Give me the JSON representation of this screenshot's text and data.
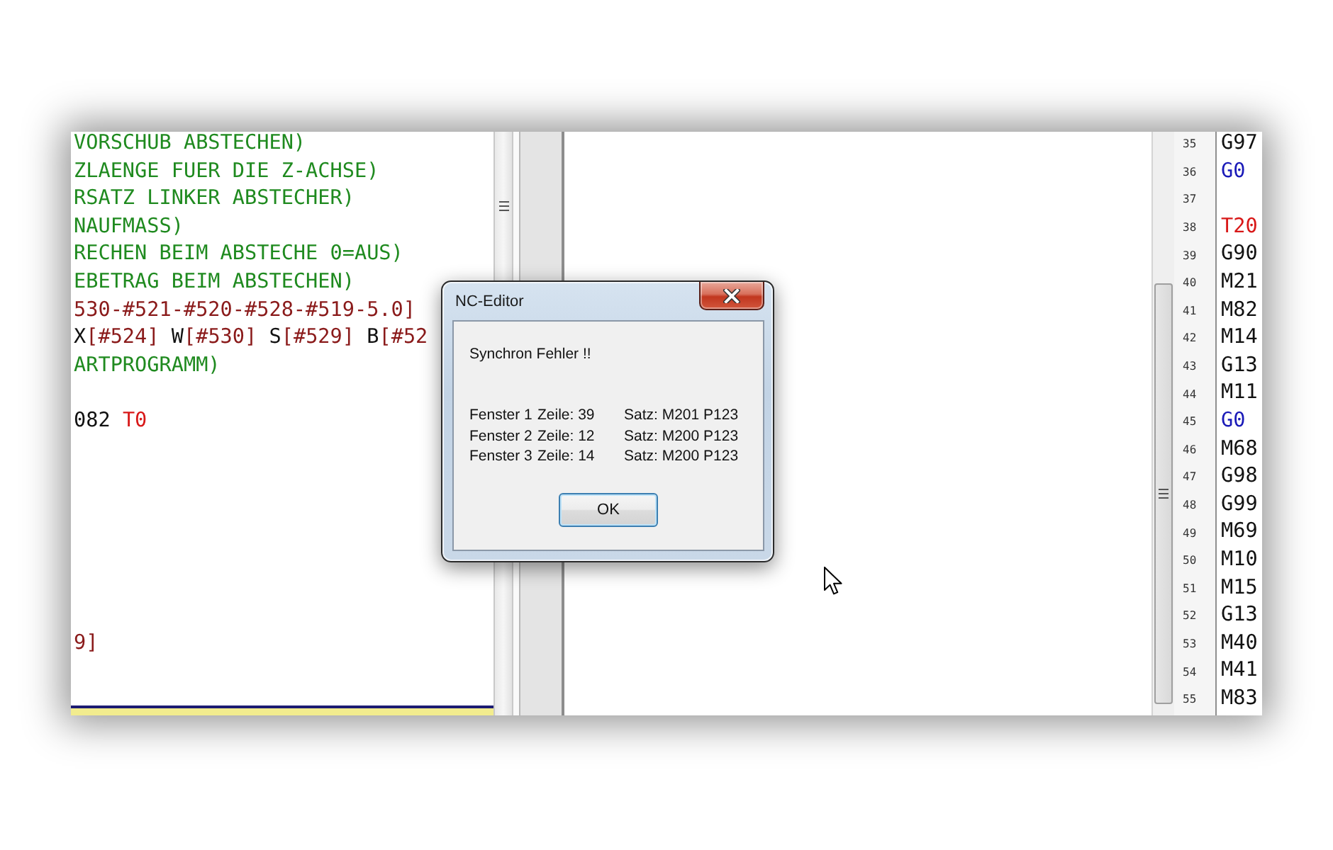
{
  "left_editor": {
    "blocks": [
      {
        "lines": [
          {
            "segments": [
              {
                "text": "VORSCHUB ABSTECHEN)",
                "kind": "comment"
              }
            ]
          },
          {
            "segments": [
              {
                "text": "ZLAENGE FUER DIE Z-ACHSE)",
                "kind": "comment"
              }
            ]
          },
          {
            "segments": [
              {
                "text": "RSATZ LINKER ABSTECHER)",
                "kind": "comment"
              }
            ]
          },
          {
            "segments": [
              {
                "text": "NAUFMASS)",
                "kind": "comment"
              }
            ]
          },
          {
            "segments": [
              {
                "text": "RECHEN BEIM ABSTECHE 0=AUS)",
                "kind": "comment"
              }
            ]
          },
          {
            "segments": [
              {
                "text": "EBETRAG BEIM ABSTECHEN)",
                "kind": "comment"
              }
            ]
          },
          {
            "segments": [
              {
                "text": "530-#521-#520-#528-#519-5.0]",
                "kind": "param"
              }
            ]
          },
          {
            "segments": [
              {
                "text": "X",
                "kind": "plain"
              },
              {
                "text": "[#524]",
                "kind": "param"
              },
              {
                "text": " W",
                "kind": "plain"
              },
              {
                "text": "[#530]",
                "kind": "param"
              },
              {
                "text": " S",
                "kind": "plain"
              },
              {
                "text": "[#529]",
                "kind": "param"
              },
              {
                "text": " B",
                "kind": "plain"
              },
              {
                "text": "[#52",
                "kind": "param"
              }
            ]
          },
          {
            "segments": [
              {
                "text": "ARTPROGRAMM)",
                "kind": "comment"
              }
            ]
          }
        ]
      },
      {
        "lines": [
          {
            "segments": [
              {
                "text": "082 ",
                "kind": "plain"
              },
              {
                "text": "T0",
                "kind": "tool"
              }
            ]
          }
        ]
      },
      {
        "lines": [
          {
            "segments": [
              {
                "text": "9]",
                "kind": "param"
              }
            ]
          }
        ]
      }
    ]
  },
  "right_editor": {
    "lines": [
      {
        "number": "35",
        "segments": [
          {
            "text": "G97",
            "kind": "plain"
          }
        ]
      },
      {
        "number": "36",
        "segments": [
          {
            "text": "G0",
            "kind": "rapid"
          }
        ]
      },
      {
        "number": "37"
      },
      {
        "number": "38",
        "segments": [
          {
            "text": "T20",
            "kind": "tool"
          }
        ]
      },
      {
        "number": "39",
        "segments": [
          {
            "text": "G90",
            "kind": "plain"
          }
        ]
      },
      {
        "number": "40",
        "segments": [
          {
            "text": "M21",
            "kind": "plain"
          }
        ]
      },
      {
        "number": "41",
        "segments": [
          {
            "text": "M82",
            "kind": "plain"
          }
        ]
      },
      {
        "number": "42",
        "segments": [
          {
            "text": "M14",
            "kind": "plain"
          }
        ]
      },
      {
        "number": "43",
        "segments": [
          {
            "text": "G13",
            "kind": "plain"
          }
        ]
      },
      {
        "number": "44",
        "segments": [
          {
            "text": "M11",
            "kind": "plain"
          }
        ]
      },
      {
        "number": "45",
        "segments": [
          {
            "text": "G0",
            "kind": "rapid"
          }
        ]
      },
      {
        "number": "46",
        "segments": [
          {
            "text": "M68",
            "kind": "plain"
          }
        ]
      },
      {
        "number": "47",
        "segments": [
          {
            "text": "G98",
            "kind": "plain"
          }
        ]
      },
      {
        "number": "48",
        "segments": [
          {
            "text": "G99",
            "kind": "plain"
          }
        ]
      },
      {
        "number": "49",
        "segments": [
          {
            "text": "M69",
            "kind": "plain"
          }
        ]
      },
      {
        "number": "50",
        "segments": [
          {
            "text": "M10",
            "kind": "plain"
          }
        ]
      },
      {
        "number": "51",
        "segments": [
          {
            "text": "M15",
            "kind": "plain"
          }
        ]
      },
      {
        "number": "52",
        "segments": [
          {
            "text": "G13",
            "kind": "plain"
          }
        ]
      },
      {
        "number": "53",
        "segments": [
          {
            "text": "M40",
            "kind": "plain"
          }
        ]
      },
      {
        "number": "54",
        "segments": [
          {
            "text": "M41",
            "kind": "plain"
          }
        ]
      },
      {
        "number": "55",
        "segments": [
          {
            "text": "M83",
            "kind": "plain"
          }
        ]
      }
    ]
  },
  "dialog": {
    "title": "NC-Editor",
    "message": "Synchron Fehler !!",
    "rows": [
      {
        "window": "Fenster 1",
        "line": "Zeile: 39",
        "block": "Satz: M201 P123"
      },
      {
        "window": "Fenster 2",
        "line": "Zeile: 12",
        "block": "Satz: M200 P123"
      },
      {
        "window": "Fenster 3",
        "line": "Zeile: 14",
        "block": "Satz: M200 P123"
      }
    ],
    "button": "OK"
  }
}
